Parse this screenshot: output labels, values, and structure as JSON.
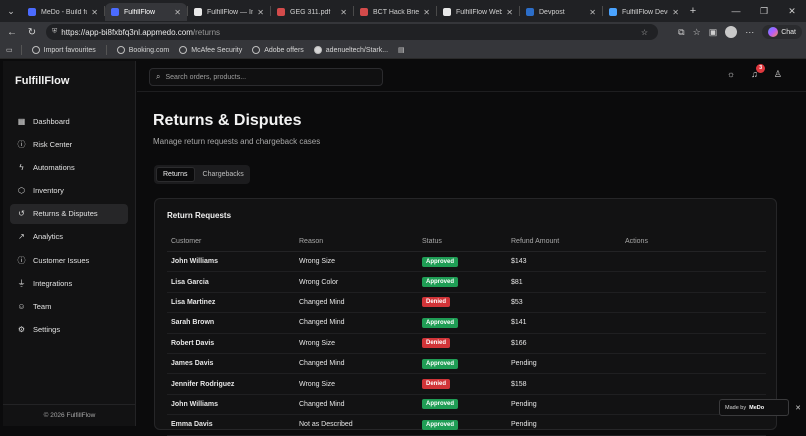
{
  "browser": {
    "tabs": [
      {
        "title": "MeDo - Build full-s",
        "color": "#4b6bff",
        "active": false
      },
      {
        "title": "FulfillFlow",
        "color": "#4b6bff",
        "active": true
      },
      {
        "title": "FulfillFlow — Inves",
        "color": "#e8e8e8",
        "active": false
      },
      {
        "title": "GEG 311.pdf",
        "color": "#d34b4b",
        "active": false
      },
      {
        "title": "BCT Hack Brief.pdf",
        "color": "#d34b4b",
        "active": false
      },
      {
        "title": "FulfillFlow Web Ap",
        "color": "#e8e8e8",
        "active": false
      },
      {
        "title": "Devpost",
        "color": "#2c6ec9",
        "active": false
      },
      {
        "title": "FulfillFlow Develop",
        "color": "#4aa3ff",
        "active": false
      }
    ],
    "url_host": "https://app-bi8fxbfq3nl.appmedo.com",
    "url_path": "/returns",
    "chat_label": "Chat",
    "bookmarks": [
      "Import favourites",
      "Booking.com",
      "McAfee Security",
      "Adobe offers",
      "adenueltech/Stark..."
    ]
  },
  "sidebar": {
    "brand": "FulfillFlow",
    "items": [
      {
        "label": "Dashboard",
        "icon": "grid-icon",
        "glyph": "▦",
        "active": false
      },
      {
        "label": "Risk Center",
        "icon": "alert-circle-icon",
        "glyph": "ⓘ",
        "active": false
      },
      {
        "label": "Automations",
        "icon": "bolt-icon",
        "glyph": "ϟ",
        "active": false
      },
      {
        "label": "Inventory",
        "icon": "box-icon",
        "glyph": "⬡",
        "active": false
      },
      {
        "label": "Returns & Disputes",
        "icon": "return-icon",
        "glyph": "↺",
        "active": true
      },
      {
        "label": "Analytics",
        "icon": "trend-icon",
        "glyph": "↗",
        "active": false
      },
      {
        "label": "Customer Issues",
        "icon": "info-icon",
        "glyph": "ⓘ",
        "active": false
      },
      {
        "label": "Integrations",
        "icon": "plug-icon",
        "glyph": "⏚",
        "active": false
      },
      {
        "label": "Team",
        "icon": "users-icon",
        "glyph": "☺",
        "active": false
      },
      {
        "label": "Settings",
        "icon": "gear-icon",
        "glyph": "⚙",
        "active": false
      }
    ],
    "footer": "© 2026 FulfillFlow"
  },
  "header": {
    "search_placeholder": "Search orders, products...",
    "notification_count": "3"
  },
  "page": {
    "title": "Returns & Disputes",
    "subtitle": "Manage return requests and chargeback cases",
    "tabs": [
      {
        "label": "Returns",
        "active": true
      },
      {
        "label": "Chargebacks",
        "active": false
      }
    ]
  },
  "returns_table": {
    "title": "Return Requests",
    "columns": [
      "Customer",
      "Reason",
      "Status",
      "Refund Amount",
      "Actions"
    ],
    "rows": [
      {
        "customer": "John Williams",
        "reason": "Wrong Size",
        "status": "Approved",
        "refund": "$143"
      },
      {
        "customer": "Lisa Garcia",
        "reason": "Wrong Color",
        "status": "Approved",
        "refund": "$81"
      },
      {
        "customer": "Lisa Martinez",
        "reason": "Changed Mind",
        "status": "Denied",
        "refund": "$53"
      },
      {
        "customer": "Sarah Brown",
        "reason": "Changed Mind",
        "status": "Approved",
        "refund": "$141"
      },
      {
        "customer": "Robert Davis",
        "reason": "Wrong Size",
        "status": "Denied",
        "refund": "$166"
      },
      {
        "customer": "James Davis",
        "reason": "Changed Mind",
        "status": "Approved",
        "refund": "Pending"
      },
      {
        "customer": "Jennifer Rodriguez",
        "reason": "Wrong Size",
        "status": "Denied",
        "refund": "$158"
      },
      {
        "customer": "John Williams",
        "reason": "Changed Mind",
        "status": "Approved",
        "refund": "Pending"
      },
      {
        "customer": "Emma Davis",
        "reason": "Not as Described",
        "status": "Approved",
        "refund": "Pending"
      }
    ]
  },
  "toast": {
    "prefix": "Made by",
    "brand": "MeDo"
  },
  "colors": {
    "approved": "#1f9d55",
    "denied": "#d13438",
    "background": "#0b0b0c"
  }
}
